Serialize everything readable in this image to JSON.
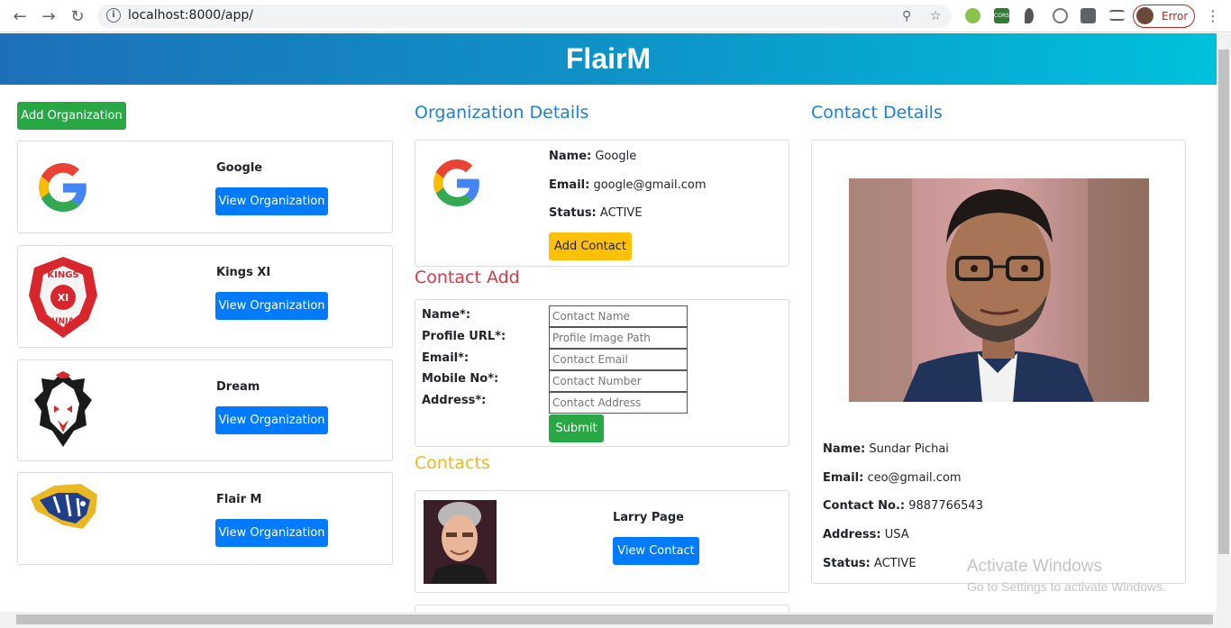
{
  "browser": {
    "url": "localhost:8000/app/",
    "profile_status": "Error",
    "extension_cors_label": "CORS"
  },
  "app": {
    "title": "FlairM"
  },
  "left": {
    "add_org_label": "Add Organization",
    "organizations": [
      {
        "name": "Google",
        "logo": "google-logo",
        "view_label": "View Organization"
      },
      {
        "name": "Kings XI",
        "logo": "kings-xi-logo",
        "logo_text_top": "KINGS",
        "logo_text_mid": "XI",
        "logo_text_bottom": "PUNJAB",
        "view_label": "View Organization"
      },
      {
        "name": "Dream",
        "logo": "lion-logo",
        "view_label": "View Organization"
      },
      {
        "name": "Flair M",
        "logo": "tiger-logo",
        "view_label": "View Organization"
      }
    ]
  },
  "org_details": {
    "title": "Organization Details",
    "name_label": "Name:",
    "name": "Google",
    "email_label": "Email:",
    "email": "google@gmail.com",
    "status_label": "Status:",
    "status": "ACTIVE",
    "add_contact_label": "Add Contact"
  },
  "contact_add": {
    "title": "Contact Add",
    "fields": [
      {
        "label": "Name*:",
        "placeholder": "Contact Name"
      },
      {
        "label": "Profile URL*:",
        "placeholder": "Profile Image Path"
      },
      {
        "label": "Email*:",
        "placeholder": "Contact Email"
      },
      {
        "label": "Mobile No*:",
        "placeholder": "Contact Number"
      },
      {
        "label": "Address*:",
        "placeholder": "Contact Address"
      }
    ],
    "submit_label": "Submit"
  },
  "contacts": {
    "title": "Contacts",
    "items": [
      {
        "name": "Larry Page",
        "view_label": "View Contact"
      }
    ]
  },
  "contact_details": {
    "title": "Contact Details",
    "name_label": "Name:",
    "name": "Sundar Pichai",
    "email_label": "Email:",
    "email": "ceo@gmail.com",
    "phone_label": "Contact No.:",
    "phone": "9887766543",
    "address_label": "Address:",
    "address": "USA",
    "status_label": "Status:",
    "status": "ACTIVE"
  },
  "watermark": {
    "line1": "Activate Windows",
    "line2": "Go to Settings to activate Windows."
  },
  "colors": {
    "primary": "#007bff",
    "success": "#28a745",
    "warning": "#ffc107",
    "danger": "#dc3545",
    "header_start": "#1d70b8",
    "header_end": "#00c1da"
  }
}
